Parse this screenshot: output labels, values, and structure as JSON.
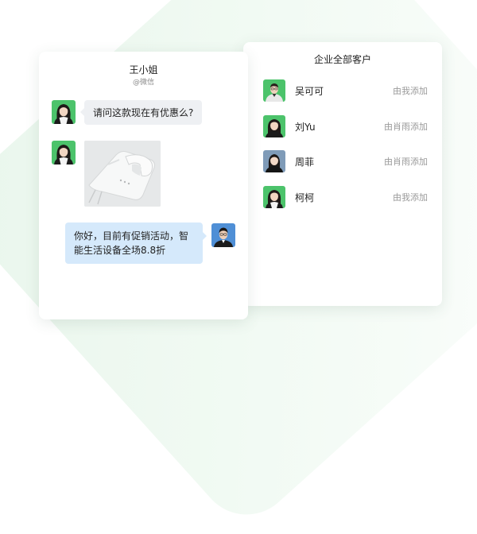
{
  "customers_panel": {
    "title": "企业全部客户",
    "items": [
      {
        "name": "吴可可",
        "source": "由我添加"
      },
      {
        "name": "刘Yu",
        "source": "由肖雨添加"
      },
      {
        "name": "周菲",
        "source": "由肖雨添加"
      },
      {
        "name": "柯柯",
        "source": "由我添加"
      }
    ]
  },
  "chat": {
    "contact_name": "王小姐",
    "contact_channel": "@微信",
    "messages": [
      {
        "direction": "incoming",
        "type": "text",
        "text": "请问这款现在有优惠么?"
      },
      {
        "direction": "incoming",
        "type": "image",
        "icon": "hand-mixer-image"
      },
      {
        "direction": "outgoing",
        "type": "text",
        "text": "你好，目前有促销活动，智能生活设备全场8.8折"
      }
    ]
  },
  "colors": {
    "bg_green": "#e9f6ec",
    "avatar_green": "#4cc36b",
    "avatar_blue_gray": "#7f9bb8",
    "avatar_blue": "#4f8fd6",
    "incoming_bubble": "#eef0f3",
    "outgoing_bubble": "#d5e9fb",
    "muted_text": "#9a9a9a"
  }
}
